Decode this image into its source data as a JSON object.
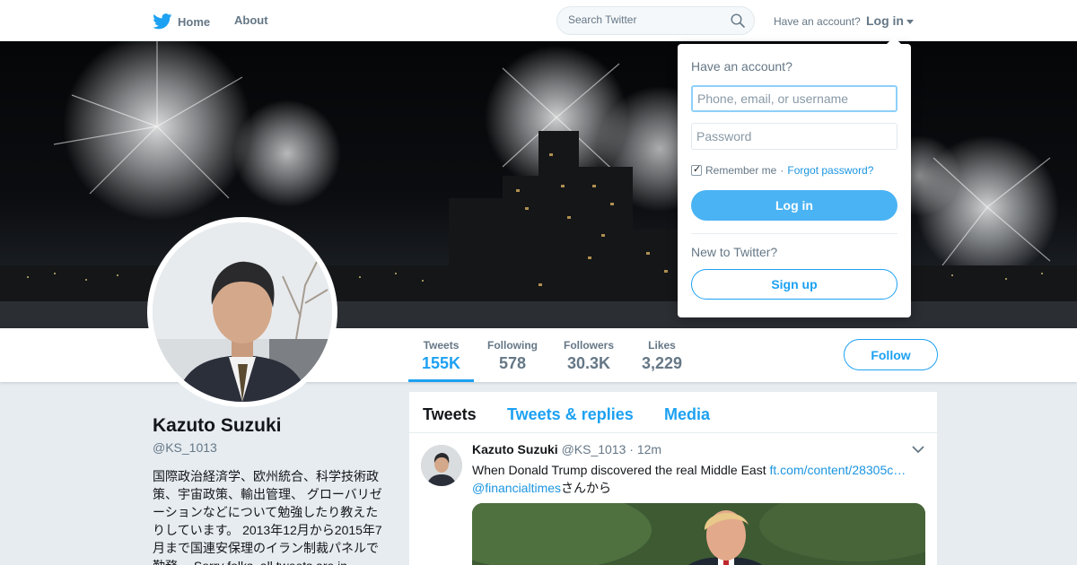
{
  "topnav": {
    "home_label": "Home",
    "about_label": "About",
    "search_placeholder": "Search Twitter",
    "have_account": "Have an account?",
    "login_label": "Log in"
  },
  "profile": {
    "name": "Kazuto Suzuki",
    "handle": "@KS_1013",
    "bio": "国際政治経済学、欧州統合、科学技術政策、宇宙政策、輸出管理、 グローバリゼーションなどについて勉強したり教えたりしています。 2013年12月から2015年7月まで国連安保理のイラン制裁パネルで勤務。 Sorry folks, all tweets are in"
  },
  "stats": [
    {
      "label": "Tweets",
      "value": "155K",
      "active": true
    },
    {
      "label": "Following",
      "value": "578"
    },
    {
      "label": "Followers",
      "value": "30.3K"
    },
    {
      "label": "Likes",
      "value": "3,229"
    }
  ],
  "follow_label": "Follow",
  "timeline": {
    "tabs": [
      "Tweets",
      "Tweets & replies",
      "Media"
    ],
    "tweet": {
      "name": "Kazuto Suzuki",
      "handle": "@KS_1013",
      "dot": "·",
      "time": "12m",
      "text": "When Donald Trump discovered the real Middle East ",
      "link": "ft.com/content/28305c…",
      "mention": "@financialtimes",
      "suffix": "さんから"
    }
  },
  "login_dropdown": {
    "title": "Have an account?",
    "username_placeholder": "Phone, email, or username",
    "password_placeholder": "Password",
    "remember_label": "Remember me",
    "separator": "·",
    "forgot_label": "Forgot password?",
    "login_button": "Log in",
    "new_label": "New to Twitter?",
    "signup_button": "Sign up"
  },
  "colors": {
    "accent": "#1da1f2",
    "login_button": "#4ab3f4",
    "muted_text": "#657786",
    "page_bg": "#e6ecf0"
  }
}
